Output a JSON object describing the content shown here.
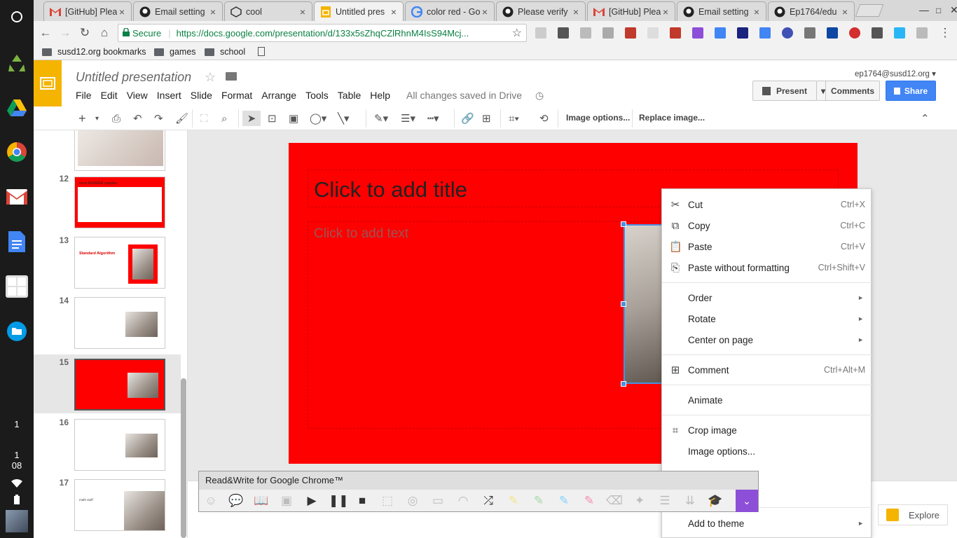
{
  "shelf": {
    "launcher": "launcher-icon",
    "apps": [
      "recycle-icon",
      "drive-icon",
      "chrome-icon",
      "gmail-icon",
      "docs-icon",
      "calculator-icon",
      "files-icon"
    ],
    "notification_count": "1",
    "clock_hour": "1",
    "clock_minute": "08"
  },
  "tabs": [
    {
      "title": "[GitHub] Plea",
      "icon": "gmail-icon"
    },
    {
      "title": "Email setting",
      "icon": "github-icon"
    },
    {
      "title": "cool",
      "icon": "codepen-icon"
    },
    {
      "title": "Untitled pres",
      "icon": "slides-icon",
      "active": true
    },
    {
      "title": "color red - Go",
      "icon": "google-icon"
    },
    {
      "title": "Please verify",
      "icon": "github-icon"
    },
    {
      "title": "[GitHub] Plea",
      "icon": "gmail-icon"
    },
    {
      "title": "Email setting",
      "icon": "github-icon"
    },
    {
      "title": "Ep1764/edu",
      "icon": "github-icon"
    }
  ],
  "omnibox": {
    "secure_label": "Secure",
    "url": "https://docs.google.com/presentation/d/133x5sZhqCZlRhnM4IsS94Mcj..."
  },
  "bookmarks": [
    {
      "label": "susd12.org bookmarks",
      "icon": "folder-icon"
    },
    {
      "label": "games",
      "icon": "folder-icon"
    },
    {
      "label": "school",
      "icon": "folder-icon"
    },
    {
      "label": "",
      "icon": "page-icon"
    }
  ],
  "slides": {
    "doc_title": "Untitled presentation",
    "account": "ep1764@susd12.org",
    "menus": [
      "File",
      "Edit",
      "View",
      "Insert",
      "Slide",
      "Format",
      "Arrange",
      "Tools",
      "Table",
      "Help"
    ],
    "save_status": "All changes saved in Drive",
    "present_label": "Present",
    "comments_label": "Comments",
    "share_label": "Share",
    "image_options_label": "Image options...",
    "replace_image_label": "Replace image..."
  },
  "filmstrip": {
    "slides": [
      {
        "num": "",
        "bg": "#ffffff"
      },
      {
        "num": "12",
        "bg": "#ff0000",
        "caption": "more ANSWER samples"
      },
      {
        "num": "13",
        "bg": "#ffffff",
        "caption": "Standard Algorithm"
      },
      {
        "num": "14",
        "bg": "#ffffff"
      },
      {
        "num": "15",
        "bg": "#ff0000",
        "selected": true
      },
      {
        "num": "16",
        "bg": "#ffffff"
      },
      {
        "num": "17",
        "bg": "#ffffff",
        "caption": "math stuff"
      }
    ]
  },
  "slide": {
    "title_placeholder": "Click to add title",
    "body_placeholder": "Click to add text",
    "bg_color": "#ff0000"
  },
  "context_menu": [
    {
      "label": "Cut",
      "shortcut": "Ctrl+X",
      "icon": "scissors-icon"
    },
    {
      "label": "Copy",
      "shortcut": "Ctrl+C",
      "icon": "copy-icon"
    },
    {
      "label": "Paste",
      "shortcut": "Ctrl+V",
      "icon": "paste-icon"
    },
    {
      "label": "Paste without formatting",
      "shortcut": "Ctrl+Shift+V",
      "icon": "paste-plain-icon"
    },
    {
      "label": "Order",
      "submenu": true
    },
    {
      "label": "Rotate",
      "submenu": true
    },
    {
      "label": "Center on page",
      "submenu": true
    },
    {
      "label": "Comment",
      "shortcut": "Ctrl+Alt+M",
      "icon": "add-comment-icon"
    },
    {
      "label": "Animate"
    },
    {
      "label": "Crop image",
      "icon": "crop-icon"
    },
    {
      "label": "Image options..."
    },
    {
      "label": "Add to theme",
      "submenu": true
    }
  ],
  "readwrite": {
    "title": "Read&Write for Google Chrome™"
  },
  "explore_label": "Explore"
}
